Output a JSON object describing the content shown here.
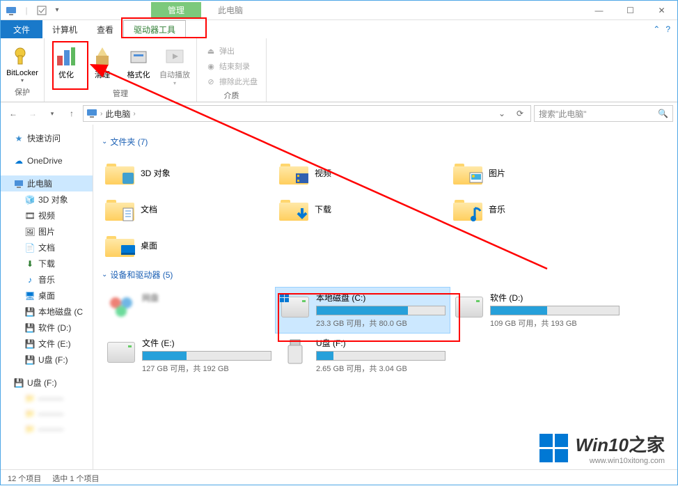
{
  "titlebar": {
    "context_tab": "管理",
    "context_label": "此电脑"
  },
  "window_controls": {
    "min": "—",
    "max": "☐",
    "close": "✕"
  },
  "ribbon_tabs": {
    "file": "文件",
    "computer": "计算机",
    "view": "查看",
    "drive_tools": "驱动器工具"
  },
  "ribbon": {
    "protect": {
      "bitlocker": "BitLocker",
      "group": "保护"
    },
    "manage": {
      "optimize": "优化",
      "cleanup": "清理",
      "format": "格式化",
      "autoplay": "自动播放",
      "group": "管理"
    },
    "media": {
      "eject": "弹出",
      "finish_burn": "结束刻录",
      "erase_disc": "擦除此光盘",
      "group": "介质"
    }
  },
  "addr": {
    "root": "此电脑",
    "refresh": "⟳",
    "dropdown": "⌄"
  },
  "search": {
    "placeholder": "搜索\"此电脑\""
  },
  "nav": {
    "quick": "快速访问",
    "onedrive": "OneDrive",
    "thispc": "此电脑",
    "objects3d": "3D 对象",
    "videos": "视频",
    "pictures": "图片",
    "documents": "文档",
    "downloads": "下载",
    "music": "音乐",
    "desktop": "桌面",
    "cdrive": "本地磁盘 (C",
    "ddrive": "软件 (D:)",
    "edrive": "文件 (E:)",
    "fdrive": "U盘 (F:)",
    "fdrive2": "U盘 (F:)"
  },
  "content": {
    "folders_hdr": "文件夹 (7)",
    "drives_hdr": "设备和驱动器 (5)",
    "folders": {
      "objects3d": "3D 对象",
      "videos": "视频",
      "pictures": "图片",
      "documents": "文档",
      "downloads": "下载",
      "music": "音乐",
      "desktop": "桌面"
    },
    "drives": {
      "netdisk": {
        "name": "网盘"
      },
      "c": {
        "name": "本地磁盘 (C:)",
        "status": "23.3 GB 可用，共 80.0 GB",
        "fill": 71
      },
      "d": {
        "name": "软件 (D:)",
        "status": "109 GB 可用，共 193 GB",
        "fill": 44
      },
      "e": {
        "name": "文件 (E:)",
        "status": "127 GB 可用，共 192 GB",
        "fill": 34
      },
      "f": {
        "name": "U盘 (F:)",
        "status": "2.65 GB 可用，共 3.04 GB",
        "fill": 13
      }
    }
  },
  "status": {
    "items": "12 个项目",
    "selected": "选中 1 个项目"
  },
  "watermark": {
    "brand": "Win10",
    "brand_zh": "之家",
    "url": "www.win10xitong.com"
  }
}
